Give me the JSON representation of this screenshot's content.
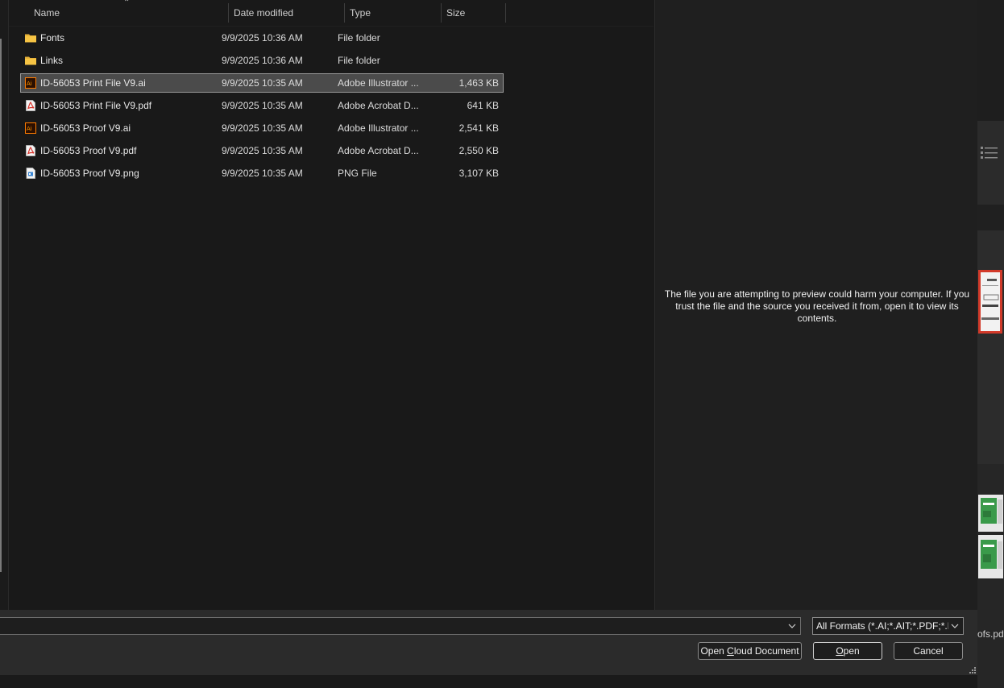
{
  "columns": {
    "name": "Name",
    "date": "Date modified",
    "type": "Type",
    "size": "Size"
  },
  "files": [
    {
      "name": "Fonts",
      "date": "9/9/2025 10:36 AM",
      "type": "File folder",
      "size": "",
      "icon": "folder-icon"
    },
    {
      "name": "Links",
      "date": "9/9/2025 10:36 AM",
      "type": "File folder",
      "size": "",
      "icon": "folder-icon"
    },
    {
      "name": "ID-56053 Print File V9.ai",
      "date": "9/9/2025 10:35 AM",
      "type": "Adobe Illustrator ...",
      "size": "1,463 KB",
      "icon": "illustrator-file-icon",
      "selected": true
    },
    {
      "name": "ID-56053 Print File V9.pdf",
      "date": "9/9/2025 10:35 AM",
      "type": "Adobe Acrobat D...",
      "size": "641 KB",
      "icon": "pdf-file-icon"
    },
    {
      "name": "ID-56053 Proof V9.ai",
      "date": "9/9/2025 10:35 AM",
      "type": "Adobe Illustrator ...",
      "size": "2,541 KB",
      "icon": "illustrator-file-icon"
    },
    {
      "name": "ID-56053 Proof V9.pdf",
      "date": "9/9/2025 10:35 AM",
      "type": "Adobe Acrobat D...",
      "size": "2,550 KB",
      "icon": "pdf-file-icon"
    },
    {
      "name": "ID-56053 Proof V9.png",
      "date": "9/9/2025 10:35 AM",
      "type": "PNG File",
      "size": "3,107 KB",
      "icon": "png-file-icon"
    }
  ],
  "preview": {
    "message": "The file you are attempting to preview could harm your computer. If you trust the file and the source you received it from, open it to view its contents."
  },
  "footer": {
    "filename_value": "",
    "filter_value": "All Formats (*.AI;*.AIT;*.PDF;*.D",
    "open_cloud_pre": "Open ",
    "open_cloud_accel": "C",
    "open_cloud_post": "loud Document",
    "open_accel": "O",
    "open_post": "pen",
    "cancel_label": "Cancel"
  },
  "background_app": {
    "partial_filename": "ofs.pdf"
  },
  "colors": {
    "selection_bg": "#4b4b4b",
    "pdf_red": "#d9342b",
    "illustrator_orange": "#ff7c00",
    "folder_yellow": "#f6c444"
  }
}
